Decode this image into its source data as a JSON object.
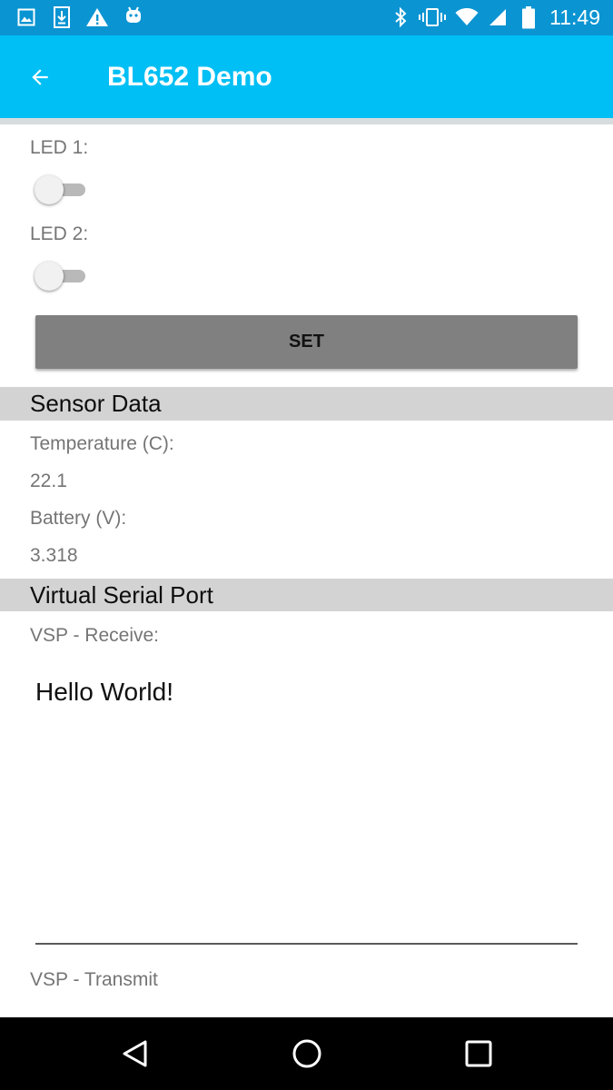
{
  "colors": {
    "status_bar": "#0a94d2",
    "app_bar": "#00bff4",
    "section_header": "#d3d3d3",
    "button": "#808080",
    "label_text": "#757575",
    "nav_bar": "#000000"
  },
  "status_bar": {
    "time": "11:49",
    "notification_icons": [
      "image-icon",
      "download-icon",
      "warning-icon",
      "android-icon"
    ],
    "system_icons": [
      "bluetooth-icon",
      "vibrate-icon",
      "wifi-icon",
      "cellular-signal-icon",
      "battery-icon"
    ]
  },
  "app_bar": {
    "back_icon": "arrow-back-icon",
    "title": "BL652 Demo"
  },
  "leds": [
    {
      "label": "LED 1:",
      "on": false
    },
    {
      "label": "LED 2:",
      "on": false
    }
  ],
  "set_button": {
    "label": "SET"
  },
  "sensor_data": {
    "header": "Sensor Data",
    "temperature_label": "Temperature (C):",
    "temperature_value": "22.1",
    "battery_label": "Battery (V):",
    "battery_value": "3.318"
  },
  "virtual_serial_port": {
    "header": "Virtual Serial Port",
    "receive_label": "VSP - Receive:",
    "receive_text": "Hello World!",
    "transmit_label": "VSP - Transmit"
  },
  "nav_bar": {
    "icons": [
      "nav-back-icon",
      "nav-home-icon",
      "nav-recents-icon"
    ]
  }
}
